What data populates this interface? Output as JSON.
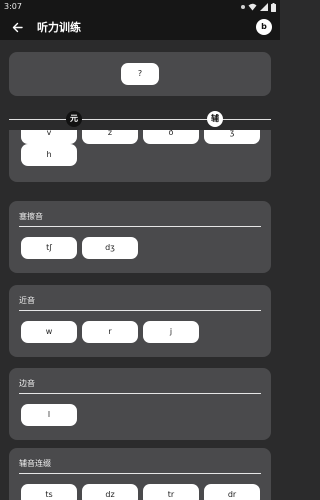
{
  "status_bar": {
    "time": "3:07"
  },
  "app_bar": {
    "title": "听力训练",
    "avatar_letter": "b",
    "back_icon": "arrow-left-icon"
  },
  "prompt": {
    "label": "?"
  },
  "tabs": {
    "vowel": "元",
    "consonant": "辅"
  },
  "groups": [
    {
      "title": "",
      "items": [
        "v",
        "z",
        "ð",
        "ʒ",
        "h"
      ]
    },
    {
      "title": "塞擦音",
      "items": [
        "tʃ",
        "dʒ"
      ]
    },
    {
      "title": "近音",
      "items": [
        "w",
        "r",
        "j"
      ]
    },
    {
      "title": "边音",
      "items": [
        "l"
      ]
    },
    {
      "title": "辅音连缀",
      "items": [
        "ts",
        "dz",
        "tr",
        "dr"
      ]
    }
  ]
}
